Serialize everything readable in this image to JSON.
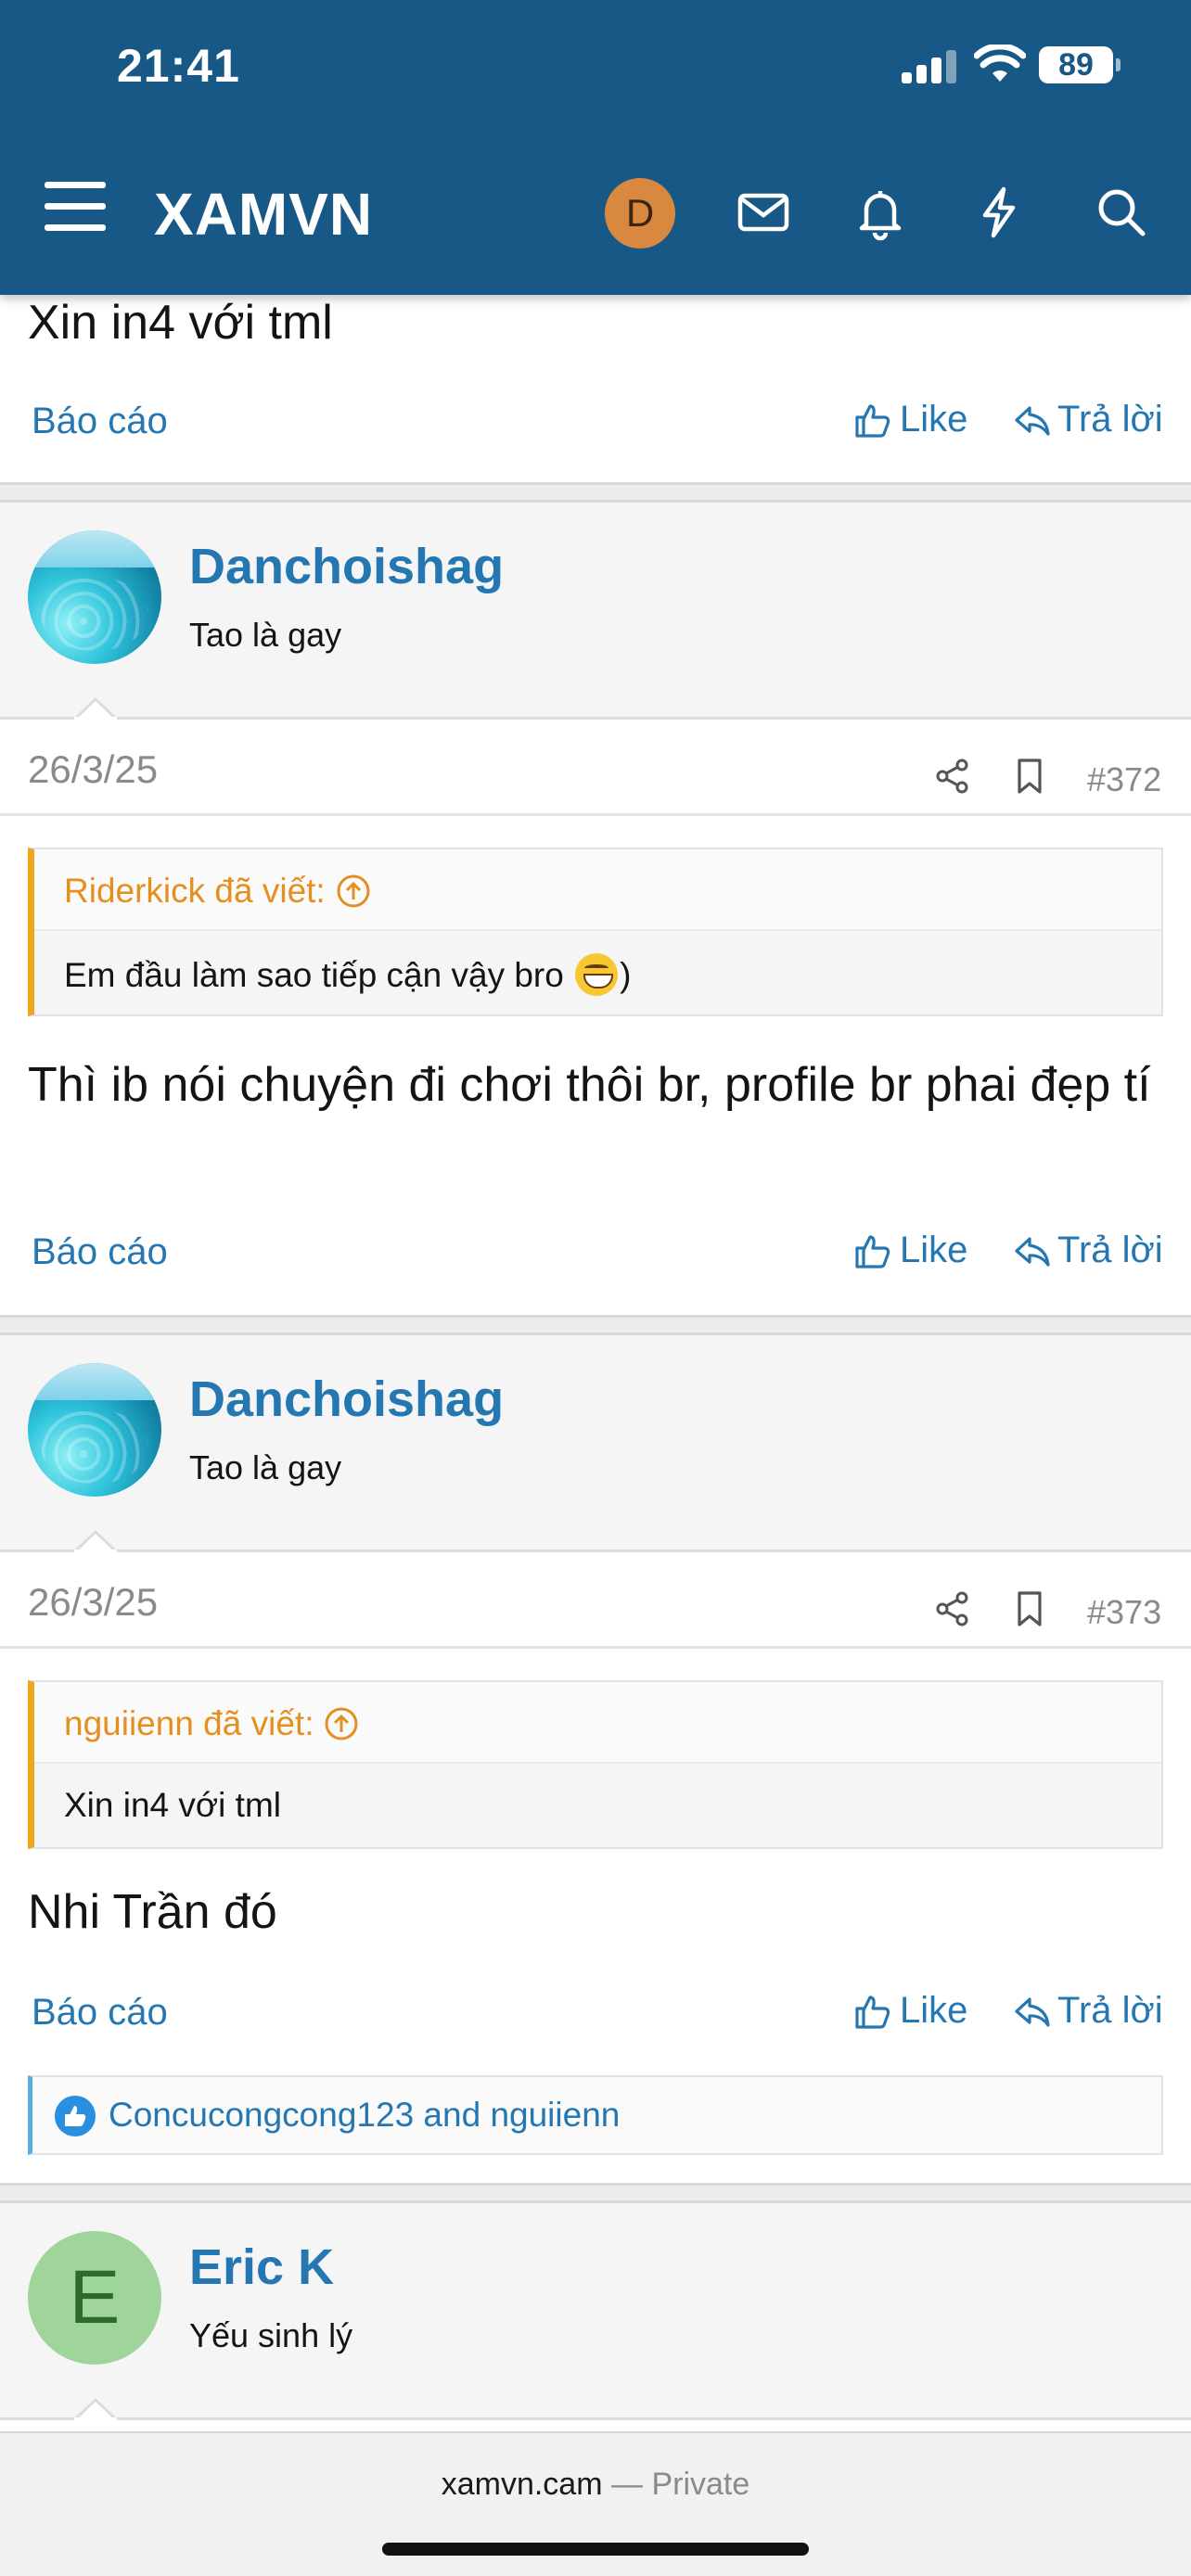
{
  "status": {
    "time": "21:41",
    "battery": "89"
  },
  "header": {
    "title": "XAMVN",
    "avatar_letter": "D"
  },
  "prev_post": {
    "text": "Xin in4 với tml"
  },
  "actions": {
    "report": "Báo cáo",
    "like": "Like",
    "reply": "Trả lời"
  },
  "posts": [
    {
      "user": "Danchoishag",
      "user_title": "Tao là gay",
      "date": "26/3/25",
      "number": "#372",
      "quote_author": "Riderkick đã viết:",
      "quote_text_before": "Em đầu làm sao tiếp cận vậy bro",
      "quote_text_after": ")",
      "body": "Thì ib nói chuyện đi chơi thôi br, profile br phai đẹp tí"
    },
    {
      "user": "Danchoishag",
      "user_title": "Tao là gay",
      "date": "26/3/25",
      "number": "#373",
      "quote_author": "nguiienn đã viết:",
      "quote_text": "Xin in4 với tml",
      "body": "Nhi Trần đó",
      "reactions": "Concucongcong123 and nguiienn"
    },
    {
      "user": "Eric K",
      "user_title": "Yếu sinh lý",
      "avatar_letter": "E"
    }
  ],
  "browser": {
    "url": "xamvn.cam",
    "separator": "—",
    "mode": "Private"
  },
  "colors": {
    "header_bg": "#185886",
    "link": "#2577b1",
    "quote_accent": "#f0a51e"
  }
}
